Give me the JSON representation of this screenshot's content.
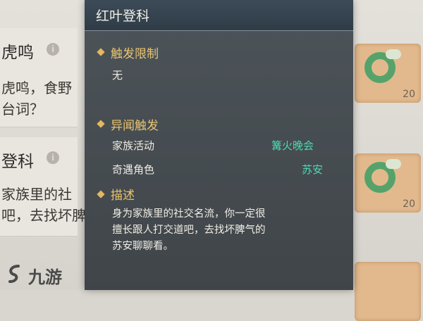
{
  "background_list": {
    "items": [
      {
        "title": "虎鸣",
        "desc_lines": [
          "虎鸣，食野",
          "台词？"
        ]
      },
      {
        "title": "登科",
        "desc_lines": [
          "家族里的社",
          "吧，去找坏脾"
        ]
      }
    ],
    "rewards": [
      {
        "count": "20"
      },
      {
        "count": "20"
      },
      {
        "count": ""
      }
    ]
  },
  "tooltip": {
    "title": "红叶登科",
    "trigger_limit": {
      "label": "触发限制",
      "value": "无"
    },
    "anecdote_trigger": {
      "label": "异闻触发",
      "rows": [
        {
          "key": "家族活动",
          "value": "篝火晚会"
        },
        {
          "key": "奇遇角色",
          "value": "苏安"
        }
      ]
    },
    "description": {
      "label": "描述",
      "lines": [
        "身为家族里的社交名流，你一定很",
        "擅长跟人打交道吧，去找坏脾气的",
        "苏安聊聊看。"
      ]
    }
  },
  "watermark": {
    "text": "九游"
  },
  "colors": {
    "accent_value": "#4fd8b2",
    "section_label": "#e9c46f",
    "panel_bg": "#454c51"
  }
}
